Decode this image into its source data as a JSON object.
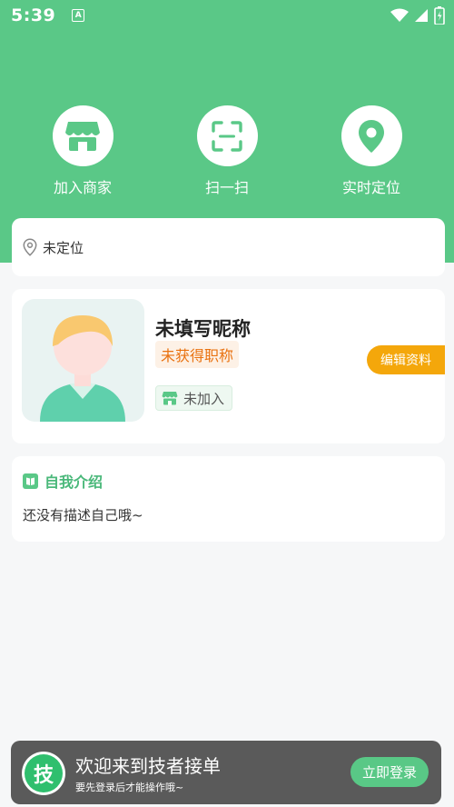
{
  "status_bar": {
    "time": "5:39",
    "notification_icon_letter": "A"
  },
  "actions": [
    {
      "label": "加入商家",
      "icon": "store-icon"
    },
    {
      "label": "扫一扫",
      "icon": "scan-icon"
    },
    {
      "label": "实时定位",
      "icon": "location-pin-icon"
    }
  ],
  "location": {
    "text": "未定位"
  },
  "profile": {
    "nickname": "未填写昵称",
    "title_badge": "未获得职称",
    "join_status": "未加入",
    "edit_button": "编辑资料"
  },
  "intro": {
    "title": "自我介绍",
    "text": "还没有描述自己哦~"
  },
  "login_banner": {
    "logo_char": "技",
    "title": "欢迎来到技者接单",
    "subtitle": "要先登录后才能操作哦~",
    "button": "立即登录"
  },
  "colors": {
    "brand_green": "#5ac887",
    "edit_orange": "#f4a70b",
    "title_orange": "#e9710f"
  }
}
